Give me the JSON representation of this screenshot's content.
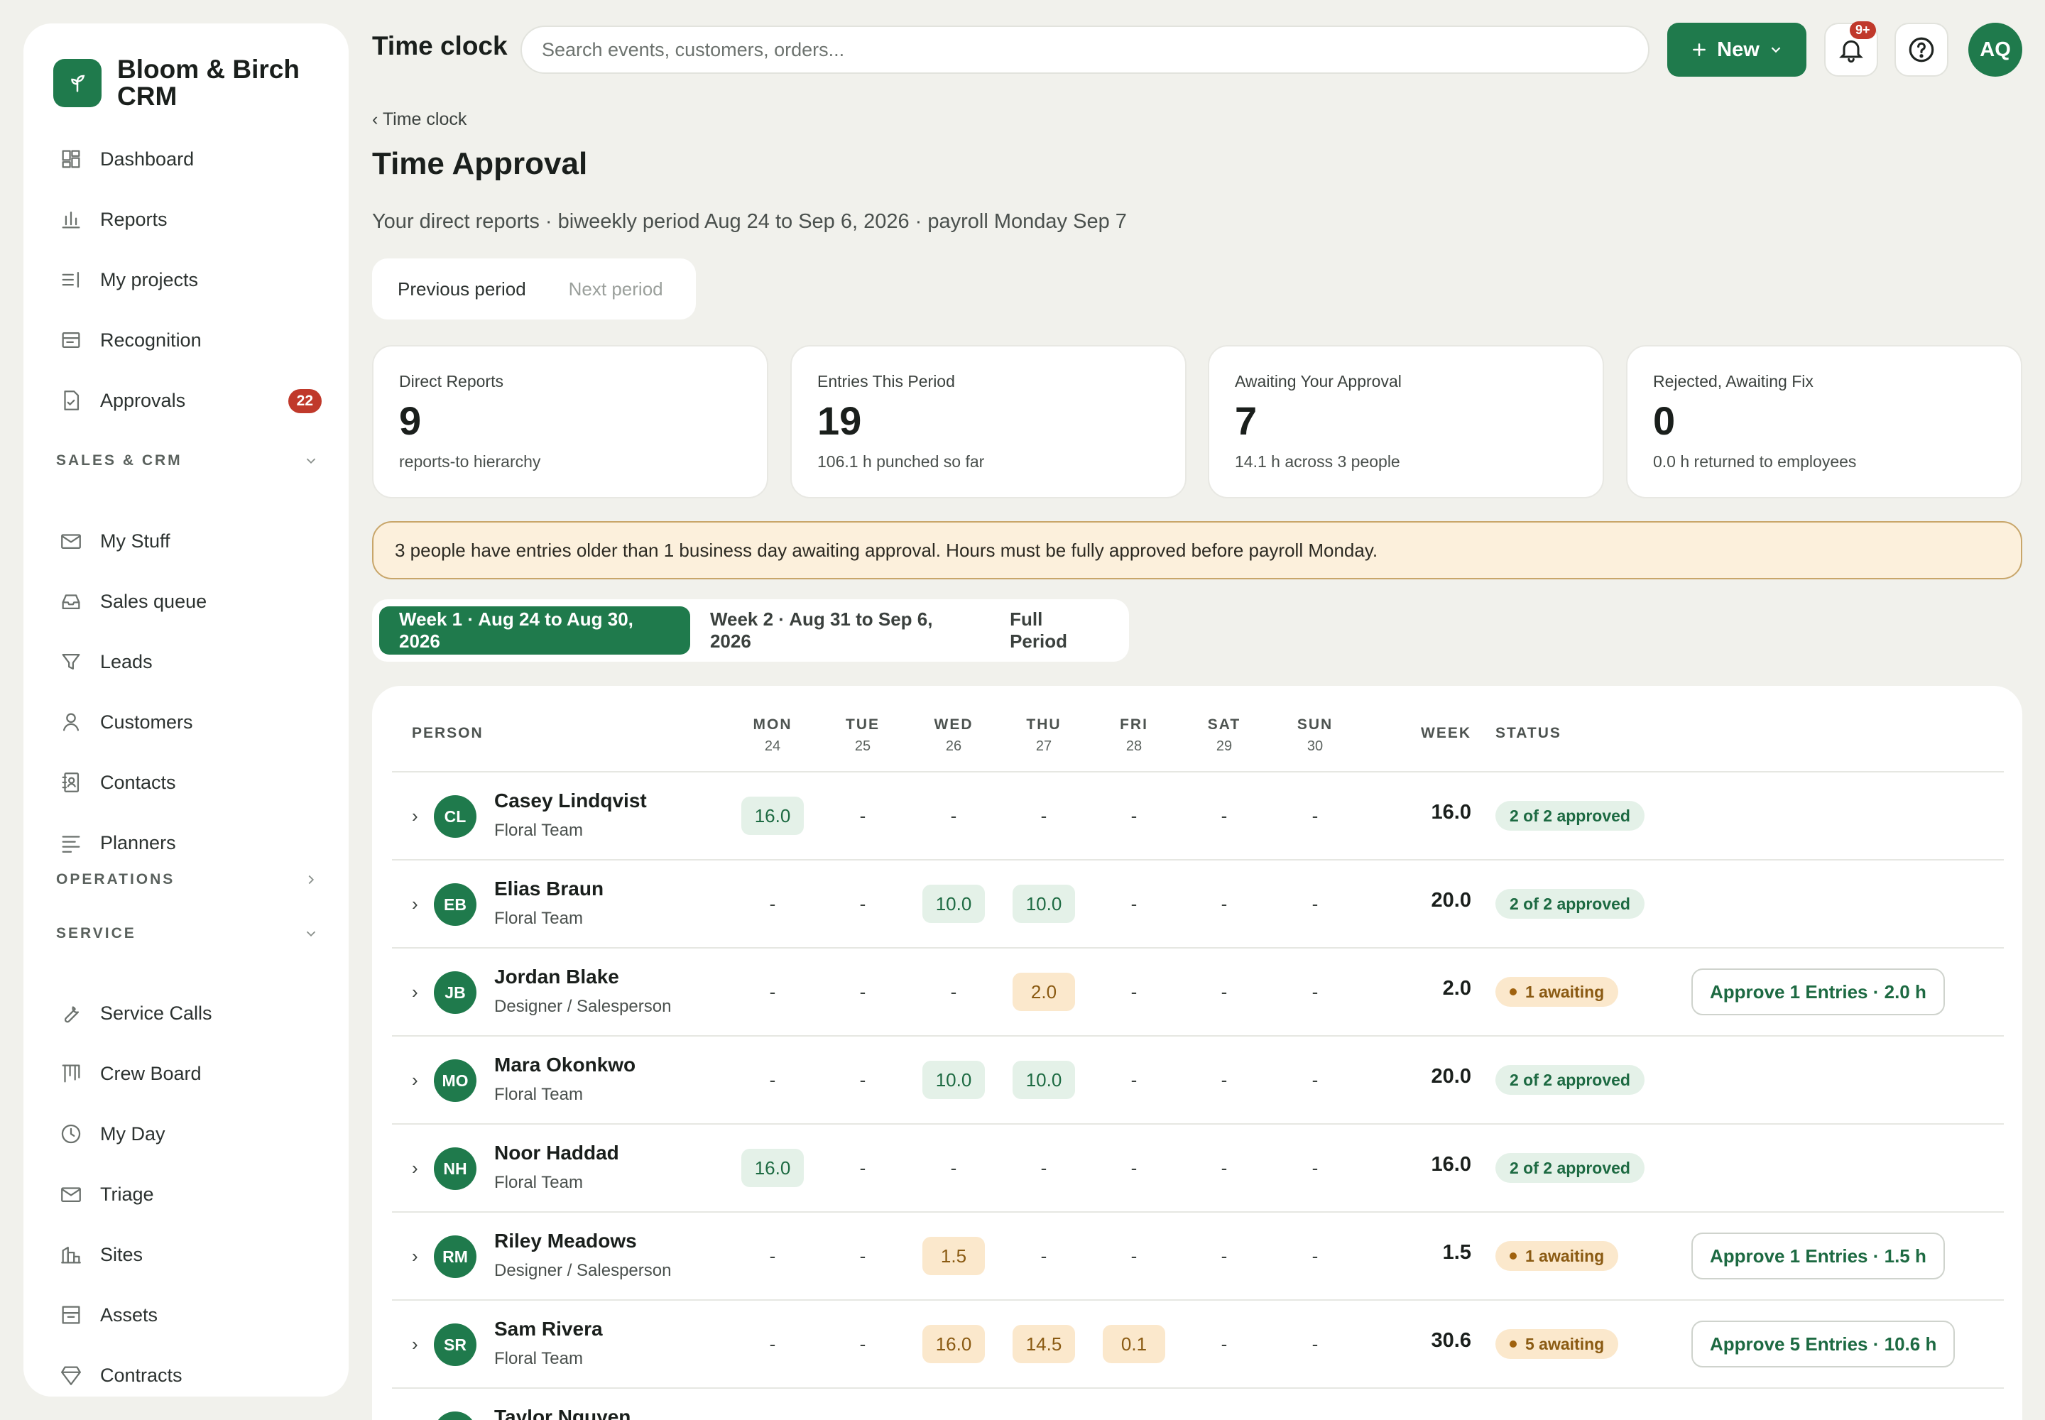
{
  "app": {
    "name": "Bloom & Birch CRM"
  },
  "header": {
    "title": "Time clock",
    "search_placeholder": "Search events, customers, orders...",
    "new_label": "New",
    "notif_count": "9+",
    "user_initials": "AQ"
  },
  "sidebar": {
    "items": [
      {
        "label": "Dashboard",
        "icon": "dashboard-icon"
      },
      {
        "label": "Reports",
        "icon": "bar-chart-icon"
      },
      {
        "label": "My projects",
        "icon": "list-icon"
      },
      {
        "label": "Recognition",
        "icon": "card-icon"
      },
      {
        "label": "Approvals",
        "icon": "document-check-icon",
        "badge": "22"
      }
    ],
    "sales_label": "SALES & CRM",
    "sales_items": [
      {
        "label": "My Stuff",
        "icon": "mail-icon"
      },
      {
        "label": "Sales queue",
        "icon": "inbox-icon"
      },
      {
        "label": "Leads",
        "icon": "funnel-icon"
      },
      {
        "label": "Customers",
        "icon": "user-icon"
      },
      {
        "label": "Contacts",
        "icon": "contact-book-icon"
      },
      {
        "label": "Planners",
        "icon": "lines-icon"
      }
    ],
    "operations_label": "OPERATIONS",
    "service_label": "SERVICE",
    "service_items": [
      {
        "label": "Service Calls",
        "icon": "wrench-icon"
      },
      {
        "label": "Crew Board",
        "icon": "board-icon"
      },
      {
        "label": "My Day",
        "icon": "clock-icon"
      },
      {
        "label": "Triage",
        "icon": "mail-icon"
      },
      {
        "label": "Sites",
        "icon": "building-icon"
      },
      {
        "label": "Assets",
        "icon": "archive-icon"
      },
      {
        "label": "Contracts",
        "icon": "diamond-icon"
      }
    ]
  },
  "page": {
    "breadcrumb": "‹ Time clock",
    "title": "Time Approval",
    "subtitle": "Your direct reports · biweekly period Aug 24 to Sep 6, 2026 · payroll Monday Sep 7",
    "prev_period": "Previous period",
    "next_period": "Next period",
    "stats": [
      {
        "label": "Direct Reports",
        "value": "9",
        "sub": "reports-to hierarchy"
      },
      {
        "label": "Entries This Period",
        "value": "19",
        "sub": "106.1 h punched so far"
      },
      {
        "label": "Awaiting Your Approval",
        "value": "7",
        "sub": "14.1 h across 3 people"
      },
      {
        "label": "Rejected, Awaiting Fix",
        "value": "0",
        "sub": "0.0 h returned to employees"
      }
    ],
    "alert": "3 people have entries older than 1 business day awaiting approval. Hours must be fully approved before payroll Monday.",
    "week_tabs": [
      "Week 1 · Aug 24 to Aug 30, 2026",
      "Week 2 · Aug 31 to Sep 6, 2026",
      "Full Period"
    ]
  },
  "table": {
    "headers": {
      "person": "PERSON",
      "days": [
        {
          "name": "MON",
          "date": "24"
        },
        {
          "name": "TUE",
          "date": "25"
        },
        {
          "name": "WED",
          "date": "26"
        },
        {
          "name": "THU",
          "date": "27"
        },
        {
          "name": "FRI",
          "date": "28"
        },
        {
          "name": "SAT",
          "date": "29"
        },
        {
          "name": "SUN",
          "date": "30"
        }
      ],
      "week": "WEEK",
      "status": "STATUS"
    },
    "rows": [
      {
        "initials": "CL",
        "name": "Casey Lindqvist",
        "team": "Floral Team",
        "days": [
          {
            "v": "16.0",
            "s": "ok"
          },
          {
            "v": "-"
          },
          {
            "v": "-"
          },
          {
            "v": "-"
          },
          {
            "v": "-"
          },
          {
            "v": "-"
          },
          {
            "v": "-"
          }
        ],
        "week": "16.0",
        "status": "2 of 2 approved",
        "status_type": "ok",
        "action": ""
      },
      {
        "initials": "EB",
        "name": "Elias Braun",
        "team": "Floral Team",
        "days": [
          {
            "v": "-"
          },
          {
            "v": "-"
          },
          {
            "v": "10.0",
            "s": "ok"
          },
          {
            "v": "10.0",
            "s": "ok"
          },
          {
            "v": "-"
          },
          {
            "v": "-"
          },
          {
            "v": "-"
          }
        ],
        "week": "20.0",
        "status": "2 of 2 approved",
        "status_type": "ok",
        "action": ""
      },
      {
        "initials": "JB",
        "name": "Jordan Blake",
        "team": "Designer / Salesperson",
        "days": [
          {
            "v": "-"
          },
          {
            "v": "-"
          },
          {
            "v": "-"
          },
          {
            "v": "2.0",
            "s": "wait"
          },
          {
            "v": "-"
          },
          {
            "v": "-"
          },
          {
            "v": "-"
          }
        ],
        "week": "2.0",
        "status": "1 awaiting",
        "status_type": "wait",
        "action": "Approve 1 Entries · 2.0 h"
      },
      {
        "initials": "MO",
        "name": "Mara Okonkwo",
        "team": "Floral Team",
        "days": [
          {
            "v": "-"
          },
          {
            "v": "-"
          },
          {
            "v": "10.0",
            "s": "ok"
          },
          {
            "v": "10.0",
            "s": "ok"
          },
          {
            "v": "-"
          },
          {
            "v": "-"
          },
          {
            "v": "-"
          }
        ],
        "week": "20.0",
        "status": "2 of 2 approved",
        "status_type": "ok",
        "action": ""
      },
      {
        "initials": "NH",
        "name": "Noor Haddad",
        "team": "Floral Team",
        "days": [
          {
            "v": "16.0",
            "s": "ok"
          },
          {
            "v": "-"
          },
          {
            "v": "-"
          },
          {
            "v": "-"
          },
          {
            "v": "-"
          },
          {
            "v": "-"
          },
          {
            "v": "-"
          }
        ],
        "week": "16.0",
        "status": "2 of 2 approved",
        "status_type": "ok",
        "action": ""
      },
      {
        "initials": "RM",
        "name": "Riley Meadows",
        "team": "Designer / Salesperson",
        "days": [
          {
            "v": "-"
          },
          {
            "v": "-"
          },
          {
            "v": "1.5",
            "s": "wait"
          },
          {
            "v": "-"
          },
          {
            "v": "-"
          },
          {
            "v": "-"
          },
          {
            "v": "-"
          }
        ],
        "week": "1.5",
        "status": "1 awaiting",
        "status_type": "wait",
        "action": "Approve 1 Entries · 1.5 h"
      },
      {
        "initials": "SR",
        "name": "Sam Rivera",
        "team": "Floral Team",
        "days": [
          {
            "v": "-"
          },
          {
            "v": "-"
          },
          {
            "v": "16.0",
            "s": "wait"
          },
          {
            "v": "14.5",
            "s": "wait"
          },
          {
            "v": "0.1",
            "s": "wait"
          },
          {
            "v": "-"
          },
          {
            "v": "-"
          }
        ],
        "week": "30.6",
        "status": "5 awaiting",
        "status_type": "wait",
        "action": "Approve 5 Entries · 10.6 h"
      },
      {
        "initials": "TN",
        "name": "Taylor Nguyen",
        "team": "",
        "days": [],
        "week": "",
        "status": "",
        "status_type": "",
        "action": ""
      }
    ]
  }
}
